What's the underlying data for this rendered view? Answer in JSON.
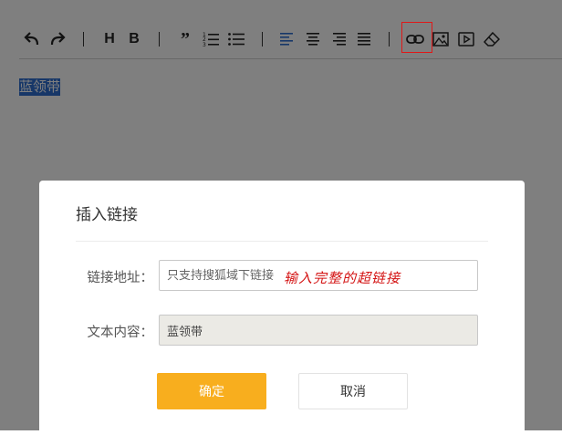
{
  "toolbar": {
    "buttons": [
      {
        "name": "undo",
        "icon": "undo-icon"
      },
      {
        "name": "redo",
        "icon": "redo-icon"
      },
      {
        "name": "heading",
        "label": "H"
      },
      {
        "name": "bold",
        "label": "B"
      },
      {
        "name": "blockquote",
        "label": "”"
      },
      {
        "name": "ordered-list",
        "icon": "ordered-list-icon"
      },
      {
        "name": "unordered-list",
        "icon": "unordered-list-icon"
      },
      {
        "name": "align-left",
        "icon": "align-left-icon",
        "active": true
      },
      {
        "name": "align-center",
        "icon": "align-center-icon"
      },
      {
        "name": "align-right",
        "icon": "align-right-icon"
      },
      {
        "name": "justify",
        "icon": "justify-icon"
      },
      {
        "name": "link",
        "icon": "link-icon",
        "highlighted": true
      },
      {
        "name": "image",
        "icon": "image-icon"
      },
      {
        "name": "video",
        "icon": "video-icon"
      },
      {
        "name": "clear-format",
        "icon": "eraser-icon"
      }
    ],
    "heading_label": "H",
    "bold_label": "B",
    "quote_label": "”"
  },
  "content": {
    "selected_text": "蓝领带"
  },
  "dialog": {
    "title": "插入链接",
    "url_label": "链接地址：",
    "url_placeholder": "只支持搜狐域下链接",
    "annotation": "输入完整的超链接",
    "text_label": "文本内容：",
    "text_value": "蓝领带",
    "confirm_label": "确定",
    "cancel_label": "取消"
  },
  "colors": {
    "accent_blue": "#2f6fd0",
    "confirm_button": "#f8ae1e",
    "highlight_border": "#e01818",
    "annotation": "#d41414"
  }
}
